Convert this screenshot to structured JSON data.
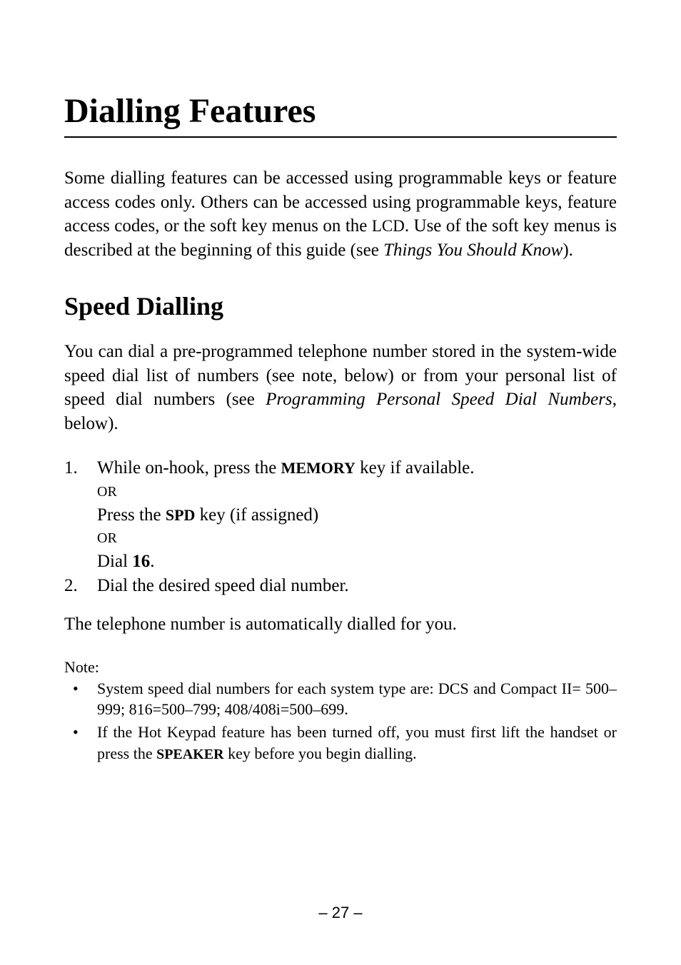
{
  "chapter": {
    "title": "Dialling Features"
  },
  "intro": {
    "part1": "Some dialling features can be accessed using programmable keys or feature access codes only. Others can be accessed using programma­ble keys, feature access codes, or the soft key menus on the ",
    "lcd": "LCD",
    "part2": ". Use of the soft key menus is described at the beginning of this guide (see ",
    "ref": "Things You Should Know",
    "part3": ")."
  },
  "section": {
    "title": "Speed Dialling",
    "desc1": "You can dial a pre-programmed telephone number stored in the sys­tem-wide speed dial list of numbers (see note, below) or from your personal list of speed dial numbers (see ",
    "ref": "Programming Personal Speed Dial Numbers",
    "desc2": ", below)."
  },
  "steps": {
    "s1": {
      "num": "1.",
      "line1a": "While on-hook, press the ",
      "memory": "MEMORY",
      "line1b": " key if available.",
      "or1": "OR",
      "line2a": "Press the ",
      "spd": "SPD",
      "line2b": " key (if assigned)",
      "or2": "OR",
      "line3a": "Dial ",
      "sixteen": "16",
      "line3b": "."
    },
    "s2": {
      "num": "2.",
      "text": "Dial the desired speed dial number."
    }
  },
  "after": "The telephone number is automatically dialled for you.",
  "notes": {
    "label": "Note:",
    "n1": "System speed dial numbers for each system type are: DCS and Compact II= 500–999; 816=500–799; 408/408i=500–699.",
    "n2a": "If the Hot Keypad feature has been turned off, you must first lift the handset or press the ",
    "speaker": "SPEAKER",
    "n2b": " key before you begin dialling."
  },
  "pagenum": "– 27 –"
}
